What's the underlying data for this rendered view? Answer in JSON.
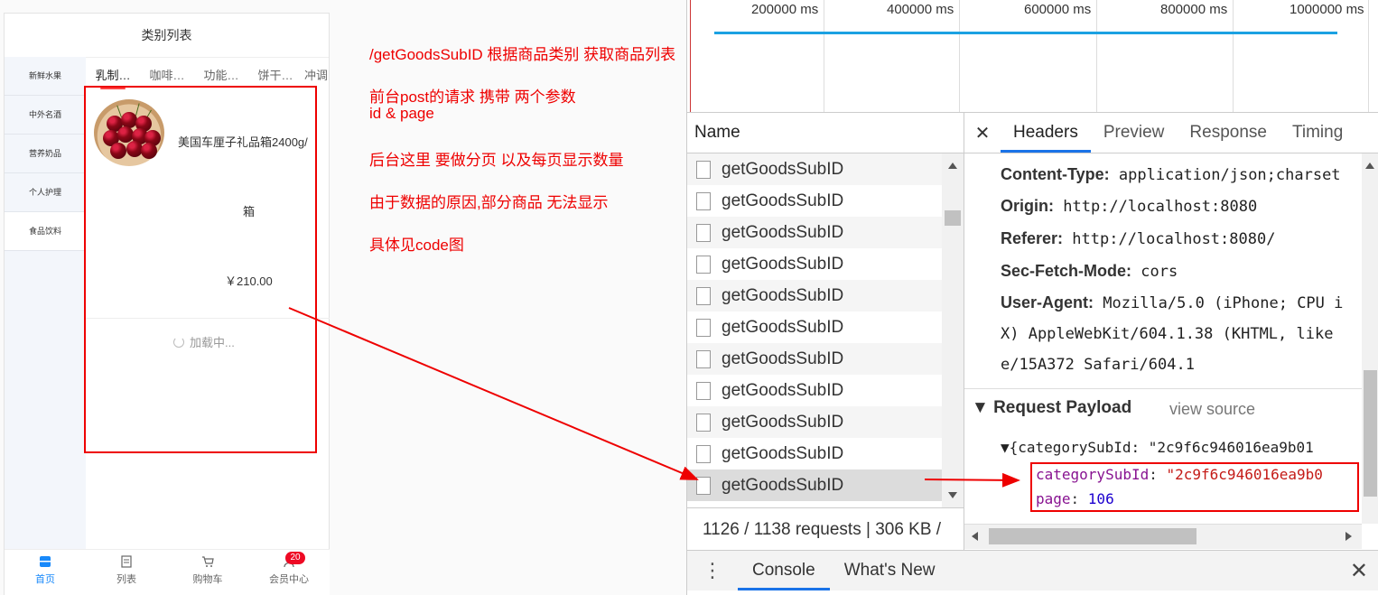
{
  "phone": {
    "title": "类别列表",
    "categories": [
      "新鲜水果",
      "中外名酒",
      "营养奶品",
      "个人护理",
      "食品饮料"
    ],
    "subtabs": [
      "乳制…",
      "咖啡…",
      "功能…",
      "饼干…",
      "冲调"
    ],
    "goods": {
      "name": "美国车厘子礼品箱2400g/",
      "name2": "箱",
      "price": "￥210.00"
    },
    "loading": "加载中...",
    "tabbar": [
      "首页",
      "列表",
      "购物车",
      "会员中心"
    ],
    "badge": "20"
  },
  "notes": [
    "/getGoodsSubID  根据商品类别 获取商品列表",
    "前台post的请求 携带 两个参数",
    "id & page",
    "后台这里 要做分页  以及每页显示数量",
    "由于数据的原因,部分商品 无法显示",
    "具体见code图"
  ],
  "devtools": {
    "timeline_labels": [
      "200000 ms",
      "400000 ms",
      "600000 ms",
      "800000 ms",
      "1000000 ms"
    ],
    "name_header": "Name",
    "requests": [
      "getGoodsSubID",
      "getGoodsSubID",
      "getGoodsSubID",
      "getGoodsSubID",
      "getGoodsSubID",
      "getGoodsSubID",
      "getGoodsSubID",
      "getGoodsSubID",
      "getGoodsSubID",
      "getGoodsSubID",
      "getGoodsSubID"
    ],
    "status": "1126 / 1138 requests  |  306 KB /",
    "tabs": [
      "Headers",
      "Preview",
      "Response",
      "Timing"
    ],
    "headers": [
      {
        "key": "Content-Type:",
        "value": "application/json;charset"
      },
      {
        "key": "Origin:",
        "value": "http://localhost:8080"
      },
      {
        "key": "Referer:",
        "value": "http://localhost:8080/"
      },
      {
        "key": "Sec-Fetch-Mode:",
        "value": "cors"
      },
      {
        "key": "User-Agent:",
        "value": "Mozilla/5.0 (iPhone; CPU i"
      }
    ],
    "ua_cont1": "X) AppleWebKit/604.1.38 (KHTML, like",
    "ua_cont2": "e/15A372 Safari/604.1",
    "payload_title": "▼ Request Payload",
    "view_source": "view source",
    "payload_summary": "▼{categorySubId: \"2c9f6c946016ea9b01",
    "payload_key1": "categorySubId",
    "payload_val1": "\"2c9f6c946016ea9b0",
    "payload_key2": "page",
    "payload_val2": "106",
    "console_tabs": [
      "Console",
      "What's New"
    ]
  }
}
